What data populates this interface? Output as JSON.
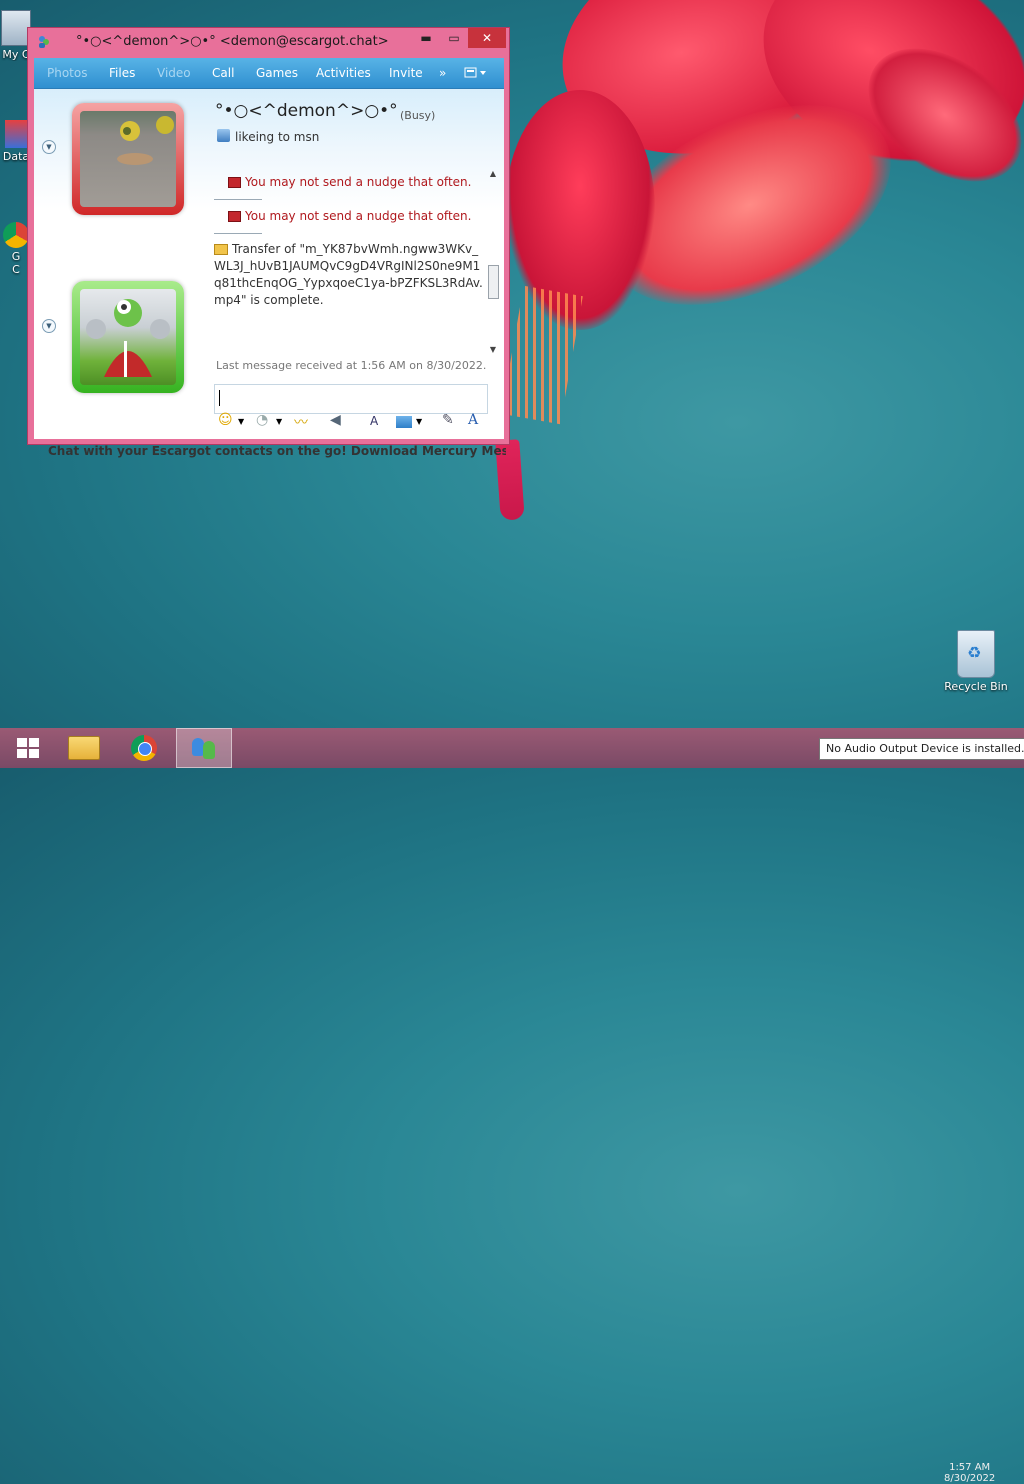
{
  "desktop": {
    "icons_left": [
      "My C",
      "Data",
      "G",
      "C"
    ],
    "recycle_bin_label": "Recycle Bin"
  },
  "window": {
    "title": "°•○<^demon^>○•° <demon@escargot.chat>",
    "minimize_glyph": "▬",
    "maximize_glyph": "▭",
    "close_glyph": "✕",
    "toolbar": {
      "items": [
        "Photos",
        "Files",
        "Video",
        "Call",
        "Games",
        "Activities",
        "Invite"
      ],
      "overflow": "»"
    },
    "contact": {
      "name": "°•○<^demon^>○•°",
      "status": "(Busy)",
      "personal_message": "likeing to msn"
    },
    "messages": [
      "You may not send a nudge that often.",
      "You may not send a nudge that often."
    ],
    "transfer_text": "Transfer of \"m_YK87bvWmh.ngww3WKv_WL3J_hUvB1JAUMQvC9gD4VRgINl2S0ne9M1q81thcEnqOG_YypxqoeC1ya-bPZFKSL3RdAv.mp4\" is complete.",
    "last_message": "Last message received at 1:56 AM on 8/30/2022.",
    "input_value": "",
    "formatting": {
      "emoticon": "☺",
      "wink": "◔",
      "nudge": "〰",
      "voice": "◀",
      "font_label": "A",
      "handwriting": "✎",
      "text_style": "A"
    },
    "footer": "Chat with your Escargot contacts on the go! Download Mercury Messenger (A..."
  },
  "taskbar": {
    "clock_time": "1:57 AM",
    "clock_date": "8/30/2022",
    "tooltip": "No Audio Output Device is installed."
  },
  "colors": {
    "window_frame": "#e8709a",
    "toolbar": "#2f8fd0",
    "error_text": "#b0191e"
  }
}
